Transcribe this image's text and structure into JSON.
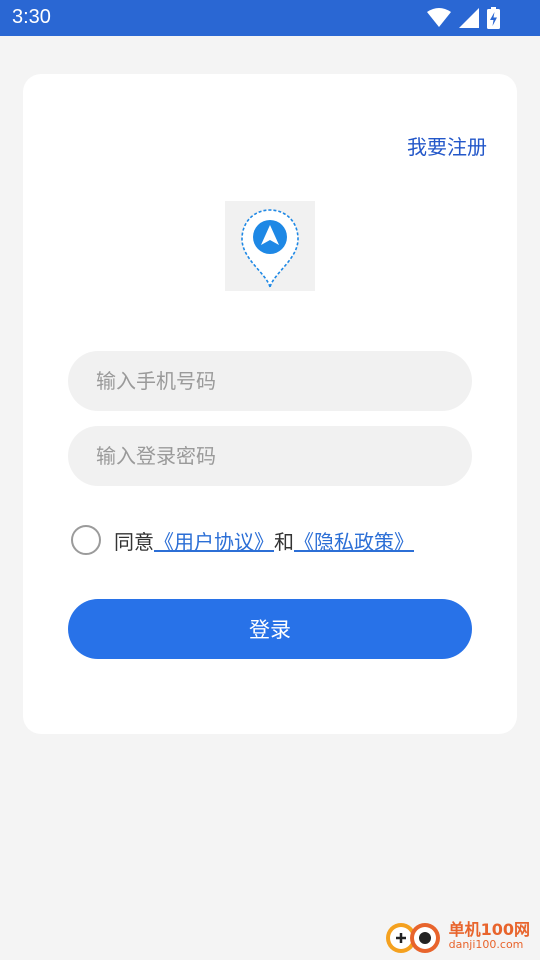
{
  "status_bar": {
    "time": "3:30",
    "icons": [
      "wifi-icon",
      "cell-signal-icon",
      "battery-charging-icon"
    ]
  },
  "register_link": "我要注册",
  "logo": {
    "icon": "location-navigation-pin-icon",
    "colors": {
      "pin": "#1e88e5",
      "arrow": "#ffffff"
    }
  },
  "phone_input": {
    "placeholder": "输入手机号码",
    "value": ""
  },
  "password_input": {
    "placeholder": "输入登录密码",
    "value": ""
  },
  "agreement": {
    "prefix": "同意",
    "user_agreement": "《用户协议》",
    "conjunction": "和",
    "privacy_policy": "《隐私政策》",
    "checked": false
  },
  "login_button": "登录",
  "watermark": {
    "brand": "单机100网",
    "url": "danji100.com"
  },
  "colors": {
    "status_bar": "#2a67d3",
    "accent": "#2872e8",
    "link": "#2357c9",
    "background": "#f4f4f4",
    "field": "#f1f1f1"
  }
}
